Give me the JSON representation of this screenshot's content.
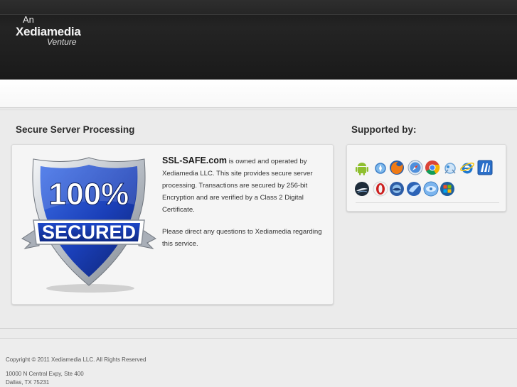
{
  "brand": {
    "prefix": "An",
    "name": "Xediamedia",
    "suffix": "Venture"
  },
  "main": {
    "heading": "Secure Server Processing",
    "badge": {
      "percent": "100%",
      "label": "SECURED"
    },
    "site_name": "SSL-SAFE.com",
    "paragraph1": " is owned and operated by Xediamedia LLC. This site provides secure server processing. Transactions are secured by 256-bit Encryption and are verified by a Class 2 Digital Certificate.",
    "paragraph2": "Please direct any questions to Xediamedia regarding this service."
  },
  "supported": {
    "heading": "Supported by:",
    "icons": [
      "android-icon",
      "safari-mobile-icon",
      "firefox-icon",
      "safari-icon",
      "chrome-icon",
      "internet-explorer-8-icon",
      "internet-explorer-icon",
      "maxthon-icon",
      "camino-icon",
      "opera-icon",
      "seamonkey-icon",
      "flock-icon",
      "konqueror-icon",
      "windows-icon"
    ]
  },
  "footer": {
    "copyright": "Copyright © 2011 Xediamedia LLC. All Rights Reserved",
    "address_line1": "10000 N Central Expy, Ste 400",
    "address_line2": "Dallas, TX 75231"
  },
  "colors": {
    "header_bg": "#1f1f1f",
    "page_bg": "#ebebeb",
    "badge_blue": "#1a3fb8",
    "badge_silver": "#c8cdd4"
  }
}
